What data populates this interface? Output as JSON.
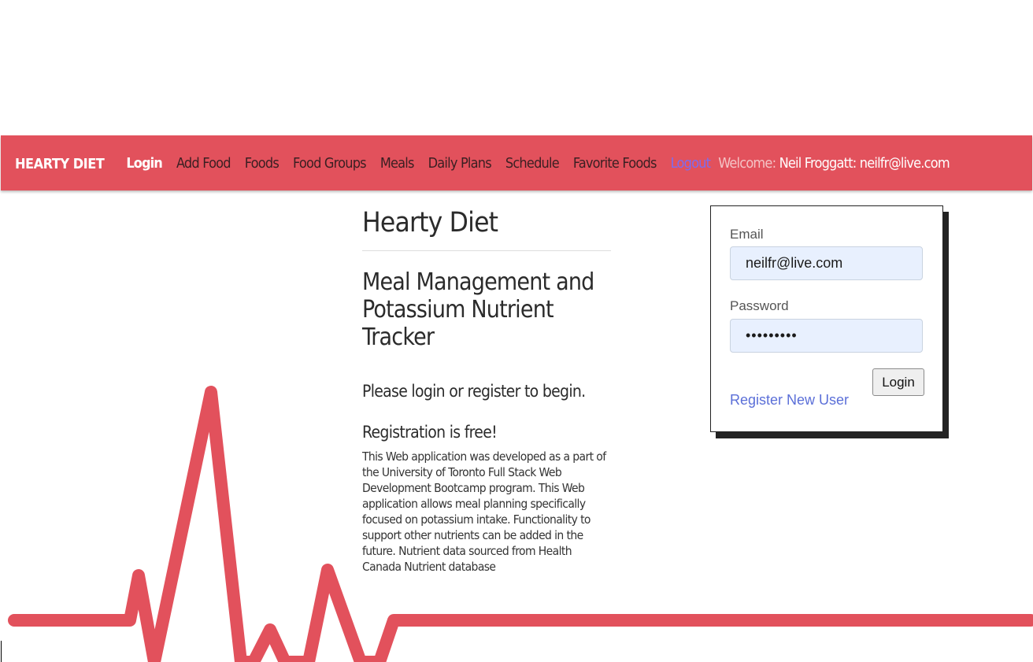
{
  "navbar": {
    "brand": "HEARTY DIET",
    "items": [
      {
        "label": "Login",
        "active": true
      },
      {
        "label": "Add Food"
      },
      {
        "label": "Foods"
      },
      {
        "label": "Food Groups"
      },
      {
        "label": "Meals"
      },
      {
        "label": "Daily Plans"
      },
      {
        "label": "Schedule"
      },
      {
        "label": "Favorite Foods"
      },
      {
        "label": "Logout"
      }
    ],
    "welcome_label": "Welcome:",
    "welcome_user": "Neil Froggatt: neilfr@live.com"
  },
  "main": {
    "title": "Hearty Diet",
    "subtitle": "Meal Management and Potassium Nutrient Tracker",
    "prompt": "Please login or register to begin.",
    "registration_note": "Registration is free!",
    "about": "This Web application was developed as a part of the University of Toronto Full Stack Web Development Bootcamp program. This Web application allows meal planning specifically focused on potassium intake. Functionality to support other nutrients can be added in the future. Nutrient data sourced from Health Canada Nutrient database"
  },
  "login_form": {
    "email_label": "Email",
    "email_value": "neilfr@live.com",
    "password_label": "Password",
    "password_value": "•••••••••",
    "login_button": "Login",
    "register_link": "Register New User"
  },
  "colors": {
    "brand_red": "#e2515c",
    "autofill_blue": "#e8f0fe",
    "link_blue": "#5b6fd8",
    "logout_purple": "#7c6cf0"
  }
}
